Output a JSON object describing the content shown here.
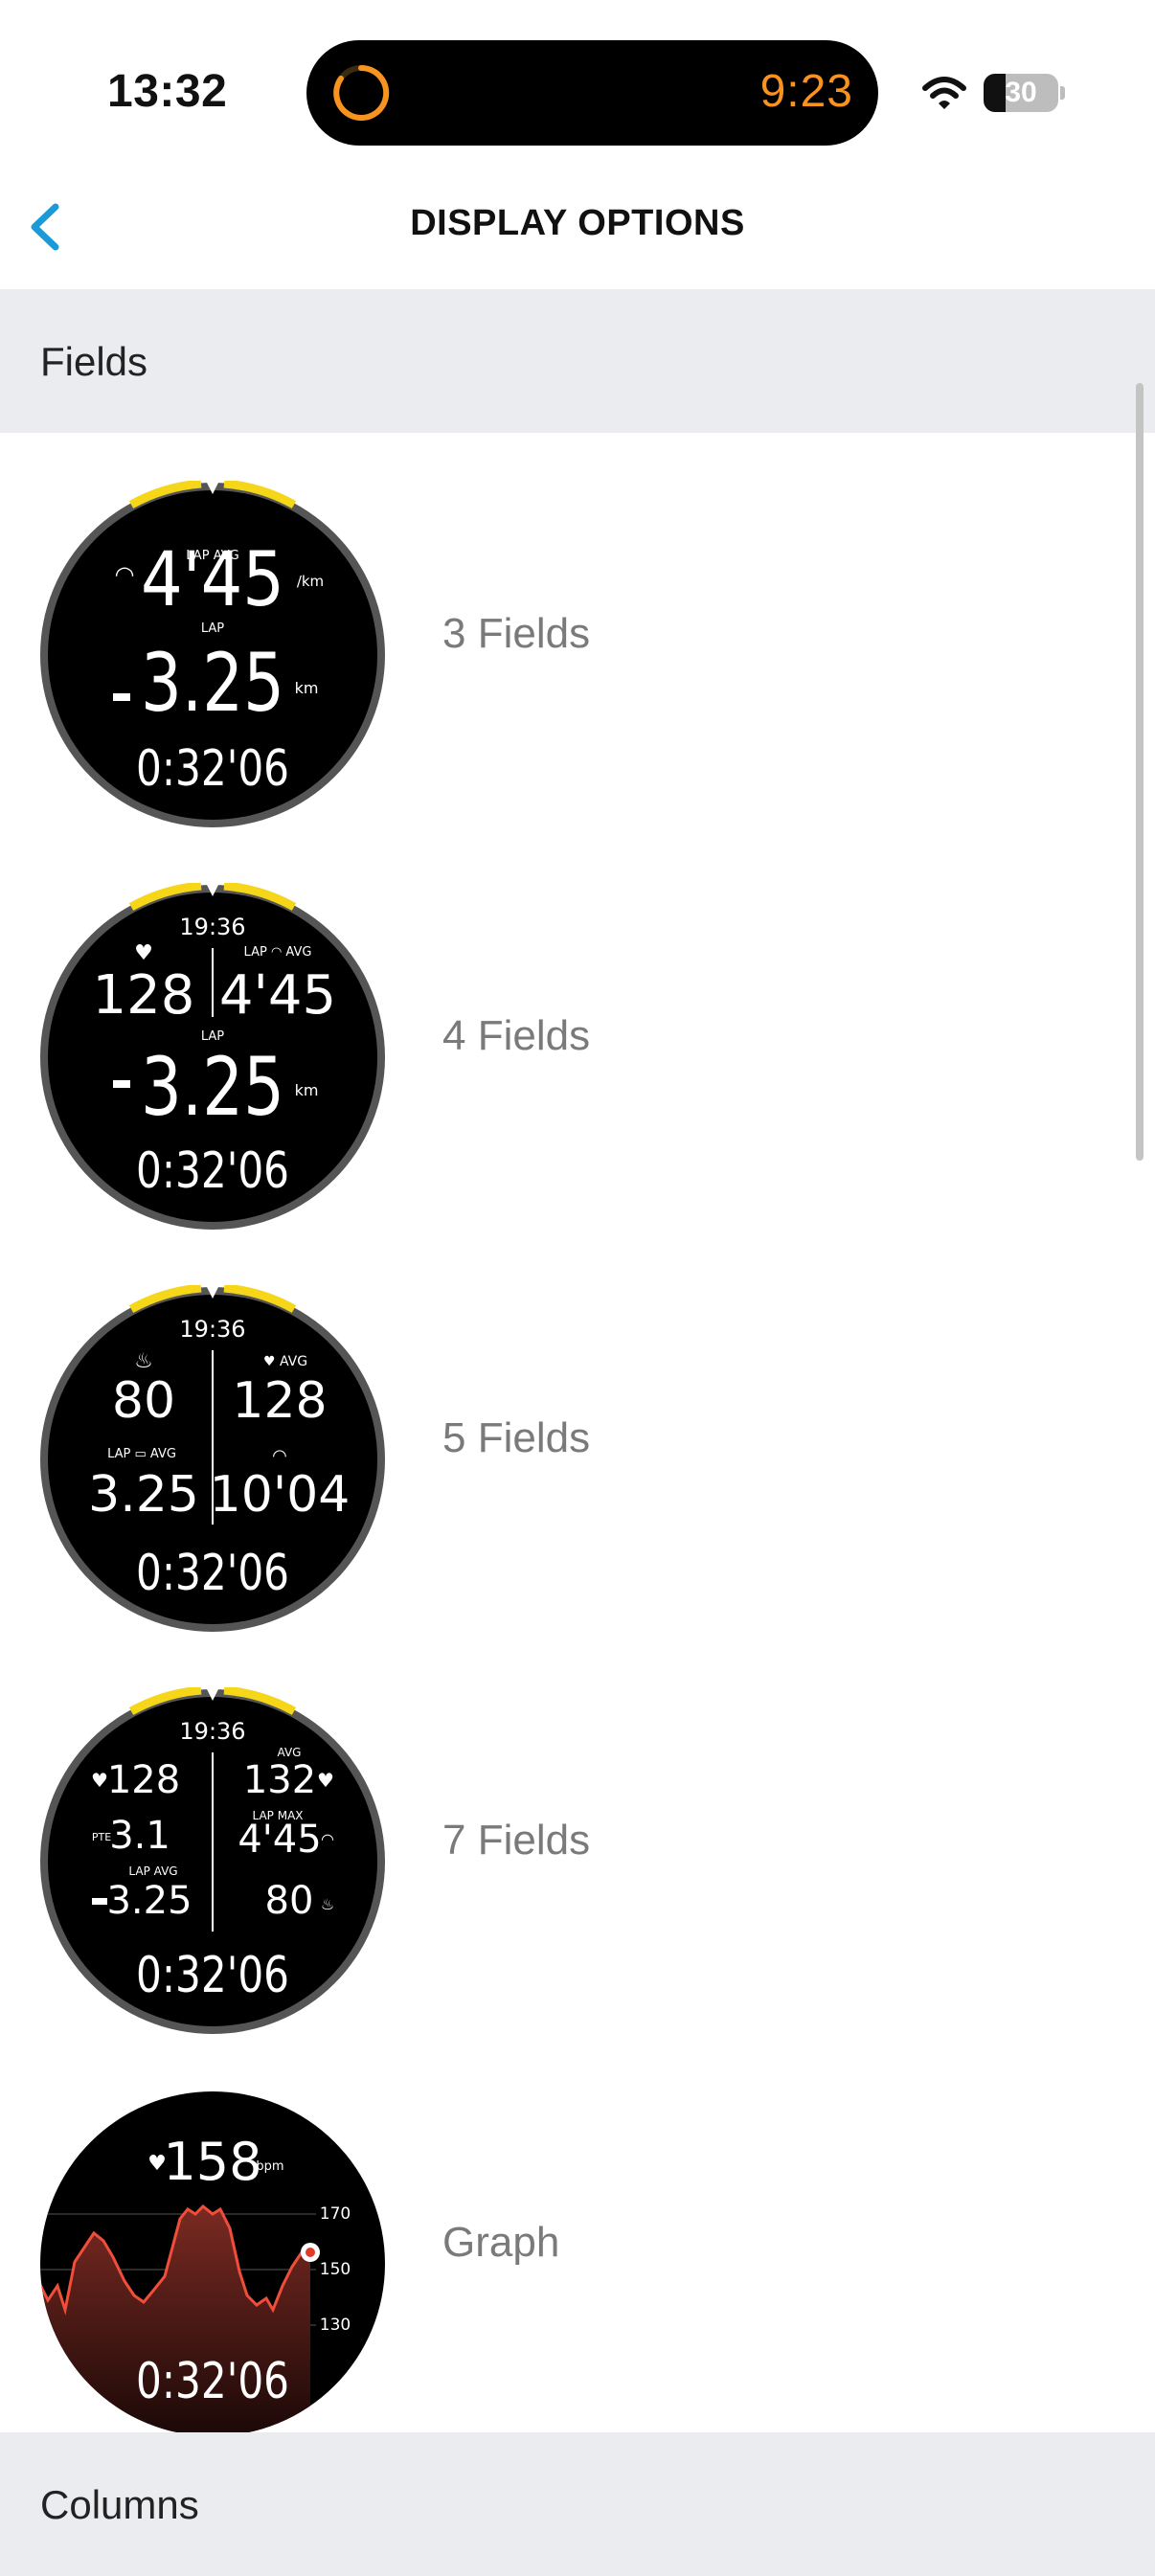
{
  "status_bar": {
    "time": "13:32",
    "island_timer": "9:23",
    "battery_level": 30,
    "battery_text": "30",
    "accent_color": "#f7931e"
  },
  "nav": {
    "title": "DISPLAY OPTIONS",
    "back_icon": "chevron-left-icon",
    "accent_color": "#1a9ad6"
  },
  "sections": {
    "fields_header": "Fields",
    "columns_header": "Columns"
  },
  "options": [
    {
      "label": "3 Fields"
    },
    {
      "label": "4 Fields"
    },
    {
      "label": "5 Fields"
    },
    {
      "label": "7 Fields"
    },
    {
      "label": "Graph"
    }
  ],
  "watch_faces": {
    "common": {
      "duration": "0:32'06",
      "clock": "19:36",
      "lap": "LAP",
      "avg": "AVG",
      "max": "MAX",
      "km": "km",
      "per_km": "/km",
      "pte": "PTE",
      "bpm": "bpm"
    },
    "three": {
      "pace": "4'45",
      "distance": "3.25"
    },
    "four": {
      "heart_rate": "128",
      "pace": "4'45",
      "distance": "3.25"
    },
    "five": {
      "calories": "80",
      "heart_rate": "128",
      "distance": "3.25",
      "pace": "10'04"
    },
    "seven": {
      "heart_rate": "128",
      "heart_rate_avg": "132",
      "pte": "3.1",
      "pace": "4'45",
      "distance": "3.25",
      "calories": "80"
    },
    "graph": {
      "heart_rate": "158",
      "y_ticks": [
        "170",
        "150",
        "130"
      ]
    }
  }
}
